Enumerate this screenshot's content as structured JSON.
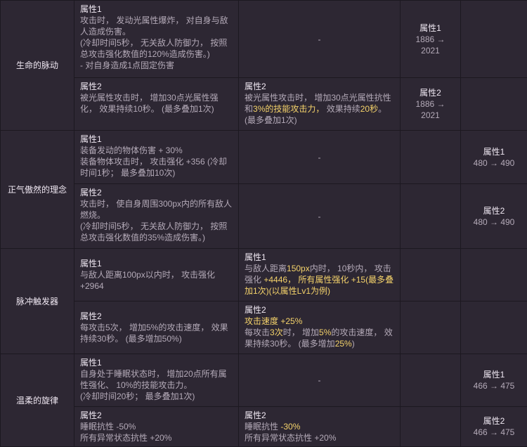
{
  "rows": [
    {
      "name": "生命的脉动",
      "props": [
        {
          "a": [
            "属性1",
            "攻击时， 发动光属性爆炸， 对自身与敌人造成伤害。",
            "(冷却时间5秒， 无关敌人防御力， 按照总攻击强化数值的120%造成伤害。)",
            "- 对自身造成1点固定伤害"
          ],
          "b": "-",
          "c": {
            "label": "属性1",
            "range": "1886 → 2021"
          },
          "d": ""
        },
        {
          "a": [
            "属性2",
            "被光属性攻击时， 增加30点光属性强化， 效果持续10秒。 (最多叠加1次)"
          ],
          "b": {
            "label": "属性2",
            "p1": "被光属性攻击时， 增加30点光属性抗性和",
            "h1": "3%的技能攻击力，",
            "p2": " 效果持续",
            "h2": "20秒",
            "p3": "。 (最多叠加1次)"
          },
          "c": {
            "label": "属性2",
            "range": "1886 → 2021"
          },
          "d": ""
        }
      ]
    },
    {
      "name": "正气傲然的理念",
      "props": [
        {
          "a": [
            "属性1",
            "装备发动的物体伤害 + 30%",
            "装备物体攻击时， 攻击强化 +356 (冷却时间1秒； 最多叠加10次)"
          ],
          "b": "-",
          "c": "",
          "d": {
            "label": "属性1",
            "range": "480 → 490"
          }
        },
        {
          "a": [
            "属性2",
            "攻击时， 使自身周围300px内的所有敌人燃烧。",
            "(冷却时间5秒， 无关敌人防御力， 按照总攻击强化数值的35%造成伤害。)"
          ],
          "b": "-",
          "c": "",
          "d": {
            "label": "属性2",
            "range": "480 → 490"
          }
        }
      ]
    },
    {
      "name": "脉冲触发器",
      "props": [
        {
          "a": [
            "属性1",
            "与敌人距离100px以内时， 攻击强化 +2964"
          ],
          "b": {
            "label": "属性1",
            "p1": "与敌人距离",
            "h1": "150px",
            "p2": "内时， 10秒内， 攻击强化 ",
            "h2": "+4446， 所有属性强化 +15(最多叠加1次)(以属性Lv1为例)",
            "p3": ""
          },
          "c": "",
          "d": ""
        },
        {
          "a": [
            "属性2",
            "每攻击5次， 增加5%的攻击速度， 效果持续30秒。 (最多增加50%)"
          ],
          "b": {
            "label": "属性2",
            "h0": "攻击速度 +25%",
            "p1": "每攻击",
            "h1": "3次",
            "p2": "时， 增加",
            "h2": "5%",
            "p3": "的攻击速度， 效果持续30秒。 (最多增加",
            "h3": "25%",
            "p4": ")"
          },
          "c": "",
          "d": ""
        }
      ]
    },
    {
      "name": "温柔的旋律",
      "props": [
        {
          "a": [
            "属性1",
            "自身处于睡眠状态时， 增加20点所有属性强化、 10%的技能攻击力。",
            "(冷却时间20秒； 最多叠加1次)"
          ],
          "b": "-",
          "c": "",
          "d": {
            "label": "属性1",
            "range": "466 → 475"
          }
        },
        {
          "a": [
            "属性2",
            "睡眠抗性 -50%",
            "所有异常状态抗性 +20%"
          ],
          "b": {
            "label": "属性2",
            "p1": "睡眠抗性 ",
            "h1": "-30%",
            "p2": "所有异常状态抗性 +20%"
          },
          "c": "",
          "d": {
            "label": "属性2",
            "range": "466 → 475"
          }
        }
      ]
    }
  ]
}
